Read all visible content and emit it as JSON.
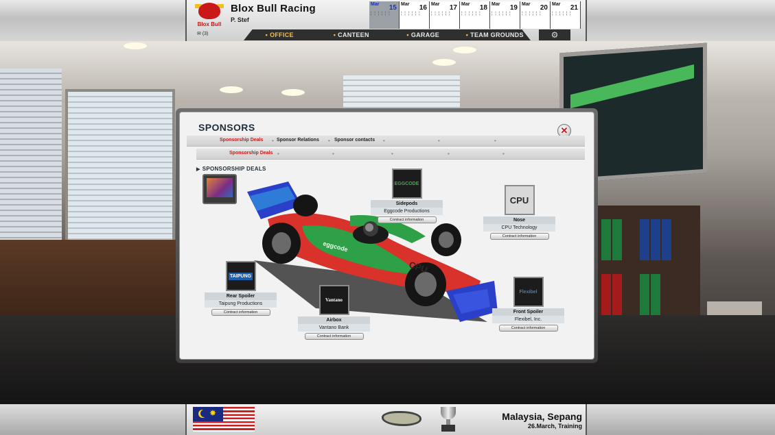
{
  "header": {
    "team_logo_text": "Blox Bull",
    "team_name": "Blox Bull Racing",
    "manager": "P. Stef",
    "messages": "(3)"
  },
  "calendar": [
    {
      "month": "Mar",
      "day": "15",
      "current": true
    },
    {
      "month": "Mar",
      "day": "16",
      "current": false
    },
    {
      "month": "Mar",
      "day": "17",
      "current": false
    },
    {
      "month": "Mar",
      "day": "18",
      "current": false
    },
    {
      "month": "Mar",
      "day": "19",
      "current": false
    },
    {
      "month": "Mar",
      "day": "20",
      "current": false
    },
    {
      "month": "Mar",
      "day": "21",
      "current": false
    }
  ],
  "nav": {
    "items": [
      {
        "label": "OFFICE",
        "active": true
      },
      {
        "label": "CANTEEN",
        "active": false
      },
      {
        "label": "GARAGE",
        "active": false
      },
      {
        "label": "TEAM GROUNDS",
        "active": false
      }
    ]
  },
  "dialog": {
    "title": "SPONSORS",
    "close_symbol": "✕",
    "tabs": [
      {
        "label": "Sponsorship Deals",
        "active": true
      },
      {
        "label": "Sponsor Relations",
        "active": false
      },
      {
        "label": "Sponsor contacts",
        "active": false
      }
    ],
    "subtabs": [
      {
        "label": "Sponsorship Deals",
        "active": true
      }
    ],
    "section_title": "SPONSORSHIP DEALS",
    "contract_button_label": "Contract information",
    "slots": [
      {
        "part": "Sidepods",
        "sponsor": "Eggcode Productions",
        "logo_text": "EGGCODE",
        "logo_color": "#3bb04a"
      },
      {
        "part": "Nose",
        "sponsor": "CPU Technology",
        "logo_text": "CPU",
        "logo_color": "#2a2a2a"
      },
      {
        "part": "Rear Spoiler",
        "sponsor": "Taipung Productions",
        "logo_text": "TAIPUNG",
        "logo_color": "#1f5fb0"
      },
      {
        "part": "Airbox",
        "sponsor": "Vantano Bank",
        "logo_text": "Vantano",
        "logo_color": "#222222"
      },
      {
        "part": "Front Spoiler",
        "sponsor": "Flexibel, Inc.",
        "logo_text": "Flexibel",
        "logo_color": "#2a2a2a"
      }
    ]
  },
  "footer": {
    "location": "Malaysia, Sepang",
    "session": "26.March, Training"
  },
  "colors": {
    "accent": "#f0c24a",
    "active_tab": "#c61a1a",
    "car_red": "#d8322a",
    "car_green": "#2ea048",
    "car_blue": "#2a40c8"
  }
}
